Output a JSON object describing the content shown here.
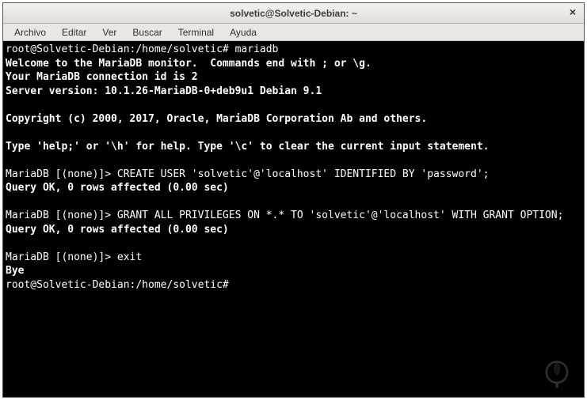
{
  "window": {
    "title": "solvetic@Solvetic-Debian: ~",
    "close": "×"
  },
  "menu": {
    "items": [
      "Archivo",
      "Editar",
      "Ver",
      "Buscar",
      "Terminal",
      "Ayuda"
    ]
  },
  "terminal": {
    "l0": "root@Solvetic-Debian:/home/solvetic# mariadb",
    "l1": "Welcome to the MariaDB monitor.  Commands end with ; or \\g.",
    "l2": "Your MariaDB connection id is 2",
    "l3": "Server version: 10.1.26-MariaDB-0+deb9u1 Debian 9.1",
    "l4": "",
    "l5": "Copyright (c) 2000, 2017, Oracle, MariaDB Corporation Ab and others.",
    "l6": "",
    "l7": "Type 'help;' or '\\h' for help. Type '\\c' to clear the current input statement.",
    "l8": "",
    "l9": "MariaDB [(none)]> CREATE USER 'solvetic'@'localhost' IDENTIFIED BY 'password';",
    "l10": "Query OK, 0 rows affected (0.00 sec)",
    "l11": "",
    "l12": "MariaDB [(none)]> GRANT ALL PRIVILEGES ON *.* TO 'solvetic'@'localhost' WITH GRANT OPTION;",
    "l13": "Query OK, 0 rows affected (0.00 sec)",
    "l14": "",
    "l15": "MariaDB [(none)]> exit",
    "l16": "Bye",
    "l17": "root@Solvetic-Debian:/home/solvetic# "
  }
}
